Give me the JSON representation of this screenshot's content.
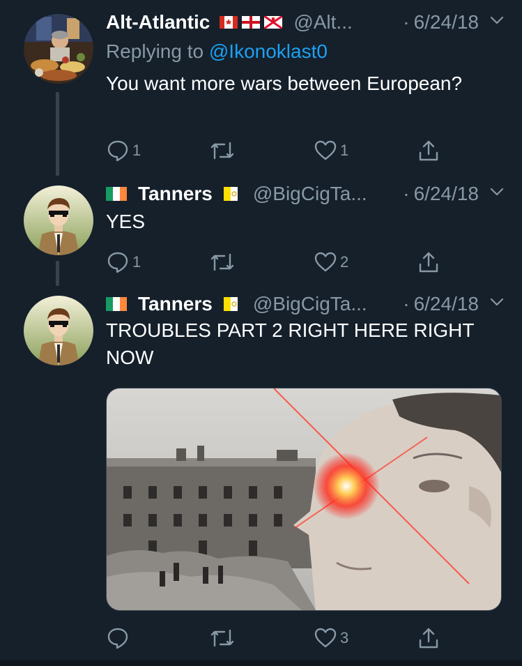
{
  "tweets": [
    {
      "name": "Alt-Atlantic",
      "handle": "@Alt...",
      "dot": "·",
      "date": "6/24/18",
      "reply_prefix": "Replying to ",
      "reply_user": "@Ikonoklast0",
      "text": "You want more wars between European?",
      "counts": {
        "reply": "1",
        "retweet": "",
        "like": "1"
      }
    },
    {
      "name": "Tanners",
      "handle": "@BigCigTa...",
      "dot": "·",
      "date": "6/24/18",
      "text": "YES",
      "counts": {
        "reply": "1",
        "retweet": "",
        "like": "2"
      }
    },
    {
      "name": "Tanners",
      "handle": "@BigCigTa...",
      "dot": "·",
      "date": "6/24/18",
      "text": "TROUBLES PART 2 RIGHT HERE RIGHT NOW",
      "counts": {
        "reply": "",
        "retweet": "",
        "like": "3"
      }
    }
  ],
  "colors": {
    "background": "#15202b",
    "secondary_text": "#8899a6",
    "link": "#1da1f2",
    "thread_line": "#38444d"
  },
  "icons": [
    "reply-icon",
    "retweet-icon",
    "like-icon",
    "share-icon",
    "chevron-down-icon"
  ]
}
